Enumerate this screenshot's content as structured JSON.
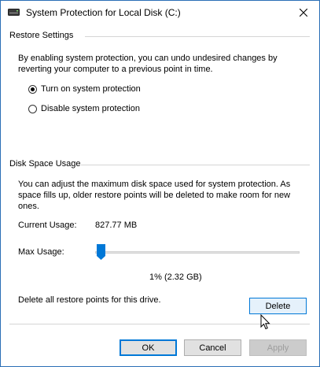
{
  "window": {
    "title": "System Protection for Local Disk (C:)",
    "icons": {
      "drive": "drive-icon",
      "close": "close-icon"
    }
  },
  "restore_settings": {
    "heading": "Restore Settings",
    "description_line1": "By enabling system protection, you can undo undesired changes by",
    "description_line2": "reverting your computer to a previous point in time.",
    "options": [
      {
        "label": "Turn on system protection",
        "selected": true
      },
      {
        "label": "Disable system protection",
        "selected": false
      }
    ]
  },
  "disk_space": {
    "heading": "Disk Space Usage",
    "description_line1": "You can adjust the maximum disk space used for system protection. As",
    "description_line2": "space fills up, older restore points will be deleted to make room for new",
    "description_line3": "ones.",
    "current_usage_label": "Current Usage:",
    "current_usage_value": "827.77 MB",
    "max_usage_label": "Max Usage:",
    "max_usage_percent": 1,
    "max_usage_text": "1% (2.32 GB)",
    "delete_text": "Delete all restore points for this drive.",
    "delete_button": "Delete"
  },
  "buttons": {
    "ok": "OK",
    "cancel": "Cancel",
    "apply": "Apply"
  },
  "colors": {
    "accent": "#0078d7",
    "window_border": "#2b6fb6",
    "disabled_text": "#9d9d9d"
  }
}
